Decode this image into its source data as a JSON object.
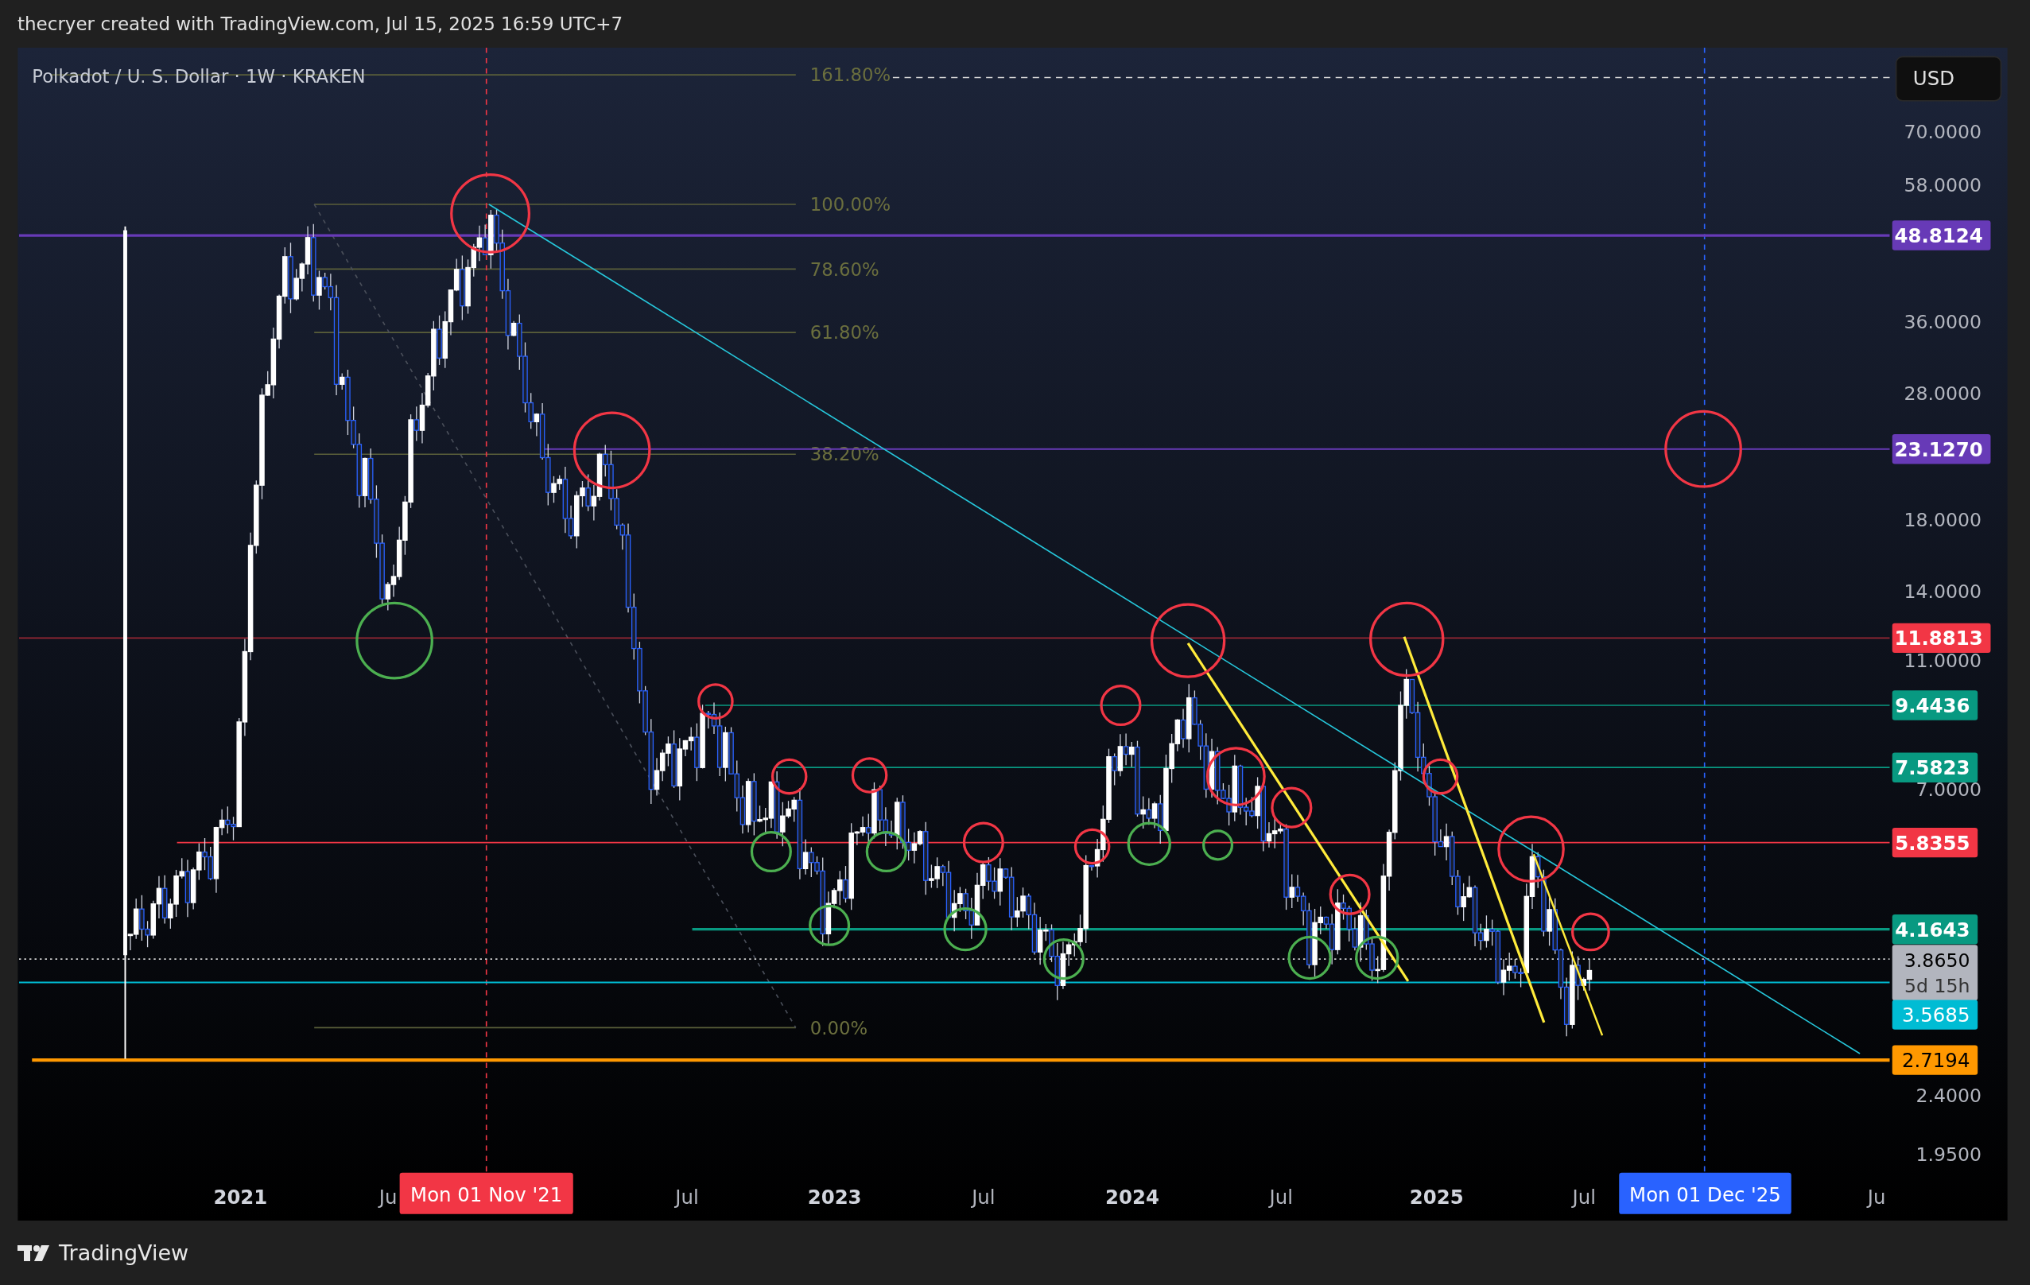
{
  "header": {
    "text": "thecryer created with TradingView.com, Jul 15, 2025 16:59 UTC+7"
  },
  "chart": {
    "legend": "Polkadot / U. S. Dollar · 1W · KRAKEN",
    "currency": "USD",
    "fib_levels": [
      "161.80%",
      "100.00%",
      "78.60%",
      "61.80%",
      "38.20%",
      "0.00%"
    ],
    "price_ticks": [
      "70.0000",
      "58.0000",
      "36.0000",
      "28.0000",
      "18.0000",
      "14.0000",
      "11.0000",
      "7.0000",
      "2.4000",
      "1.9500"
    ],
    "price_labels": [
      {
        "text": "48.8124",
        "color": "#673ab7"
      },
      {
        "text": "23.1270",
        "color": "#673ab7"
      },
      {
        "text": "11.8813",
        "color": "#f23645"
      },
      {
        "text": "9.4436",
        "color": "#089981"
      },
      {
        "text": "7.5823",
        "color": "#089981"
      },
      {
        "text": "5.8355",
        "color": "#f23645"
      },
      {
        "text": "4.1643",
        "color": "#089981"
      },
      {
        "text": "3.8650",
        "subtext": "5d 15h",
        "color": "#b2b5be"
      },
      {
        "text": "3.5685",
        "color": "#00bcd4"
      },
      {
        "text": "2.7194",
        "color": "#ff9800"
      }
    ],
    "time_ticks": [
      {
        "text": "2021",
        "kind": "year"
      },
      {
        "text": "Ju",
        "kind": "month"
      },
      {
        "text": "Jul",
        "kind": "month"
      },
      {
        "text": "2023",
        "kind": "year"
      },
      {
        "text": "Jul",
        "kind": "month"
      },
      {
        "text": "2024",
        "kind": "year"
      },
      {
        "text": "Jul",
        "kind": "month"
      },
      {
        "text": "2025",
        "kind": "year"
      },
      {
        "text": "Jul",
        "kind": "month"
      },
      {
        "text": "Ju",
        "kind": "month"
      }
    ],
    "time_markers": [
      {
        "text": "Mon 01 Nov '21",
        "color": "#f23645"
      },
      {
        "text": "Mon 01 Dec '25",
        "color": "#2962ff"
      }
    ]
  },
  "footer": {
    "logo_text": "TradingView"
  }
}
